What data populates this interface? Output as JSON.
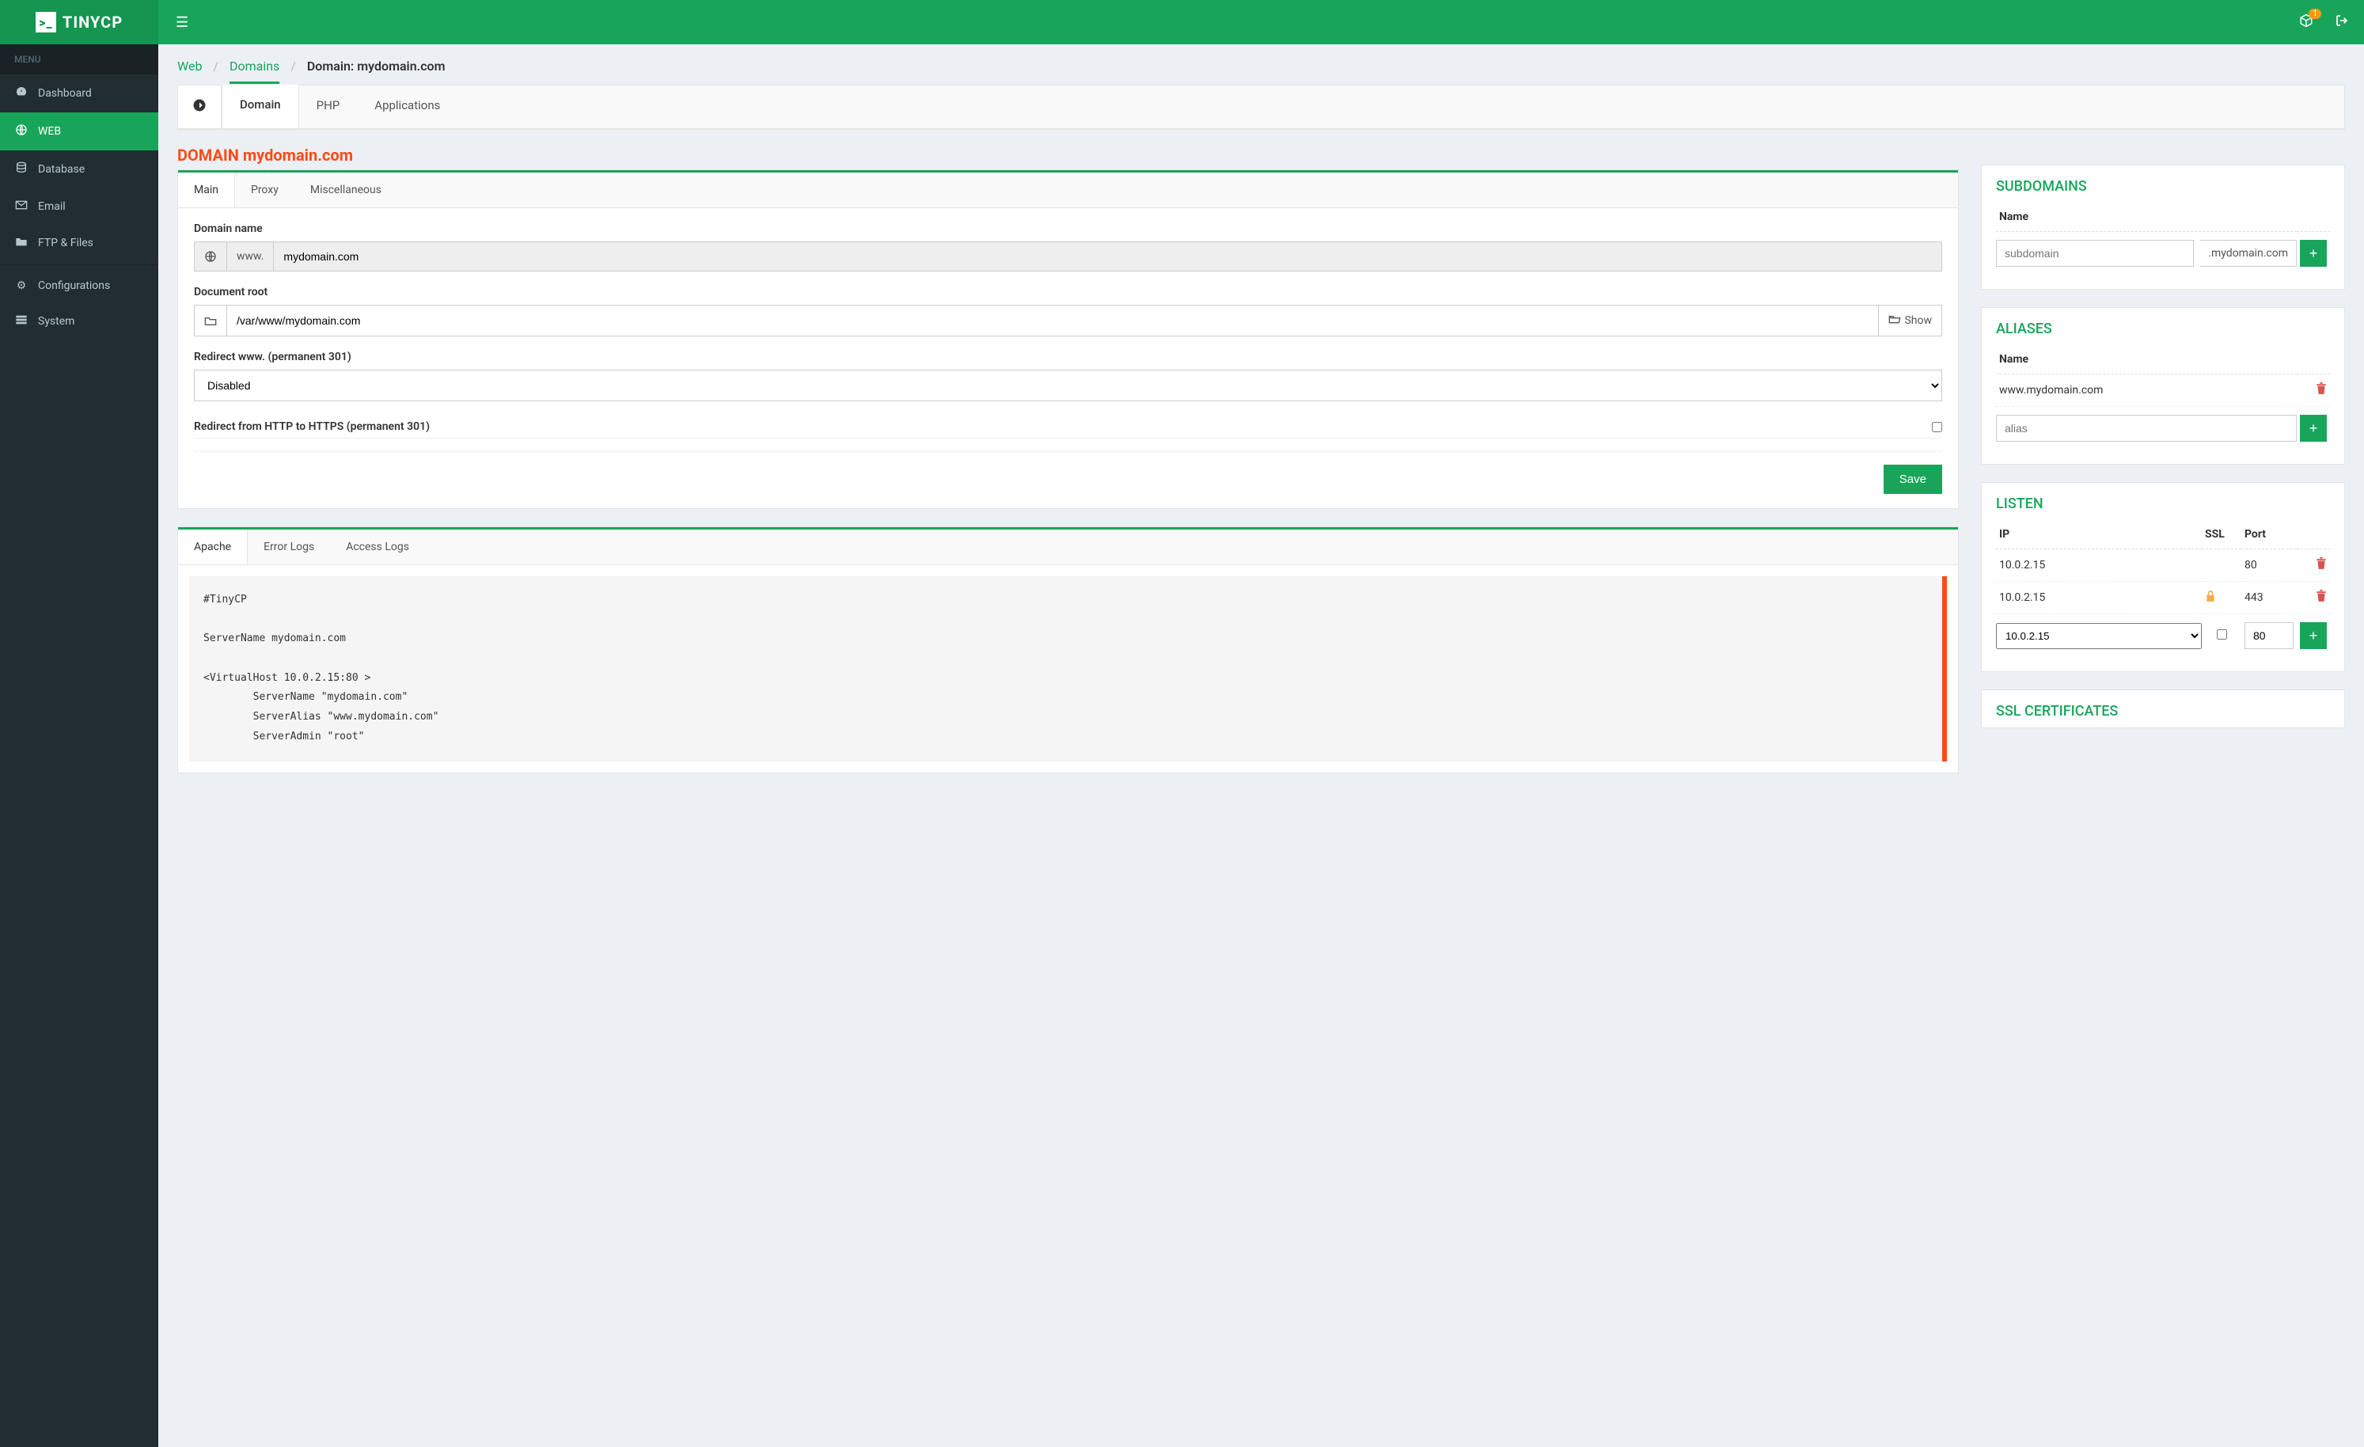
{
  "brand": "TINYCP",
  "topbar": {
    "notif_badge": "1"
  },
  "sidebar": {
    "menu_label": "MENU",
    "items": [
      {
        "icon": "dashboard",
        "label": "Dashboard"
      },
      {
        "icon": "globe",
        "label": "WEB"
      },
      {
        "icon": "database",
        "label": "Database"
      },
      {
        "icon": "mail",
        "label": "Email"
      },
      {
        "icon": "folder",
        "label": "FTP & Files"
      },
      {
        "icon": "cog",
        "label": "Configurations"
      },
      {
        "icon": "rows",
        "label": "System"
      }
    ]
  },
  "breadcrumb": {
    "a": "Web",
    "b": "Domains",
    "c": "Domain: mydomain.com"
  },
  "primary_tabs": {
    "domain": "Domain",
    "php": "PHP",
    "apps": "Applications"
  },
  "section_title": "DOMAIN mydomain.com",
  "subtabs": {
    "main": "Main",
    "proxy": "Proxy",
    "misc": "Miscellaneous"
  },
  "form": {
    "domain_name_label": "Domain name",
    "www_prefix": "www.",
    "domain_value": "mydomain.com",
    "docroot_label": "Document root",
    "docroot_value": "/var/www/mydomain.com",
    "show_btn": "Show",
    "redirect_www_label": "Redirect www. (permanent 301)",
    "redirect_www_value": "Disabled",
    "redirect_https_label": "Redirect from HTTP to HTTPS (permanent 301)",
    "save": "Save"
  },
  "logs_tabs": {
    "apache": "Apache",
    "error": "Error Logs",
    "access": "Access Logs"
  },
  "apache_conf": "#TinyCP\n\nServerName mydomain.com\n\n<VirtualHost 10.0.2.15:80 >\n        ServerName \"mydomain.com\"\n        ServerAlias \"www.mydomain.com\"\n        ServerAdmin \"root\"",
  "subdomains": {
    "title": "SUBDOMAINS",
    "name_hdr": "Name",
    "placeholder": "subdomain",
    "suffix": ".mydomain.com"
  },
  "aliases": {
    "title": "ALIASES",
    "name_hdr": "Name",
    "rows": [
      "www.mydomain.com"
    ],
    "placeholder": "alias"
  },
  "listen": {
    "title": "LISTEN",
    "hdr_ip": "IP",
    "hdr_ssl": "SSL",
    "hdr_port": "Port",
    "rows": [
      {
        "ip": "10.0.2.15",
        "ssl": false,
        "port": "80"
      },
      {
        "ip": "10.0.2.15",
        "ssl": true,
        "port": "443"
      }
    ],
    "new_ip": "10.0.2.15",
    "new_port": "80"
  },
  "ssl": {
    "title": "SSL CERTIFICATES"
  }
}
